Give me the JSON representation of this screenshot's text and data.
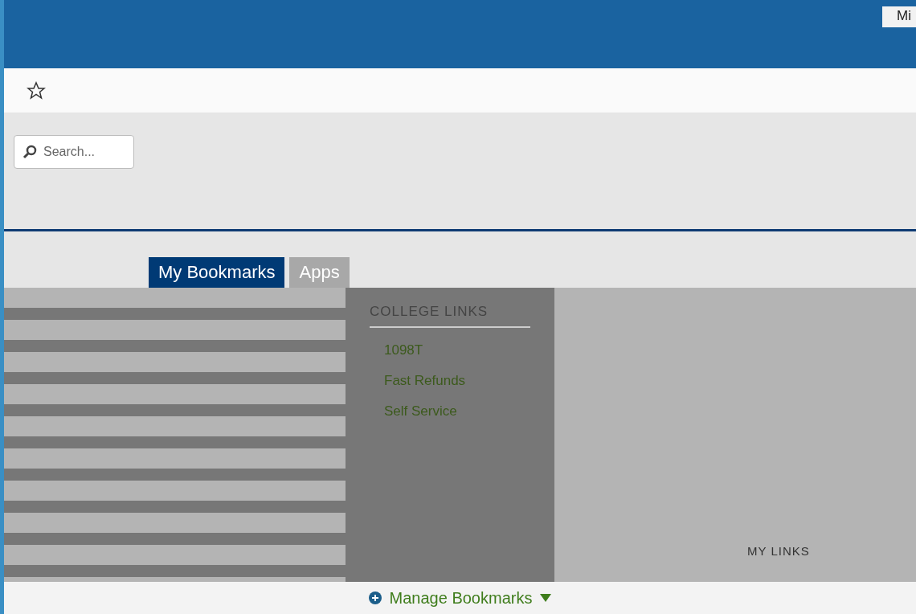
{
  "header": {
    "corner_tab": "Mi"
  },
  "search": {
    "placeholder": "Search..."
  },
  "tabs": [
    {
      "label": "My Bookmarks",
      "selected": true
    },
    {
      "label": "Apps",
      "selected": false
    }
  ],
  "college_links": {
    "title": "COLLEGE LINKS",
    "links": [
      "1098T",
      "Fast Refunds",
      "Self Service"
    ]
  },
  "my_links": {
    "title": "MY LINKS"
  },
  "footer": {
    "manage": "Manage Bookmarks"
  }
}
